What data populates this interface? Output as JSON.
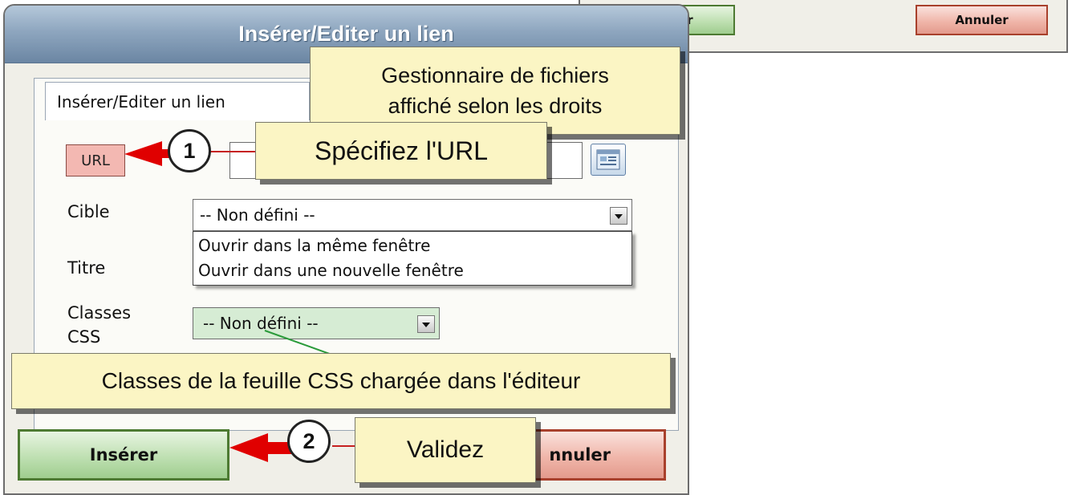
{
  "mini_dialog": {
    "insert_label": "Insérer",
    "cancel_label": "Annuler"
  },
  "dialog": {
    "title": "Insérer/Editer un lien",
    "tab_label": "Insérer/Editer un lien",
    "url_label": "URL",
    "url_value": "",
    "browse_icon": "file-browser-icon",
    "target_label": "Cible",
    "target_selected": "-- Non défini --",
    "target_options": [
      "Ouvrir dans la même fenêtre",
      "Ouvrir dans une nouvelle fenêtre"
    ],
    "title_label": "Titre",
    "css_label_line1": "Classes",
    "css_label_line2": "CSS",
    "css_selected": "-- Non défini --",
    "insert_label": "Insérer",
    "cancel_label": "Annuler",
    "cancel_visible_text": "nnuler"
  },
  "callouts": {
    "files_line1": "Gestionnaire de fichiers",
    "files_line2": "affiché selon les droits",
    "url": "Spécifiez l'URL",
    "css": "Classes de la feuille CSS chargée dans l'éditeur",
    "validate": "Validez"
  },
  "steps": {
    "one": "1",
    "two": "2"
  },
  "colors": {
    "accent_arrow": "#e00000",
    "tooltip_bg": "#fbf5c4",
    "title_bar": "#8ea6bf"
  }
}
